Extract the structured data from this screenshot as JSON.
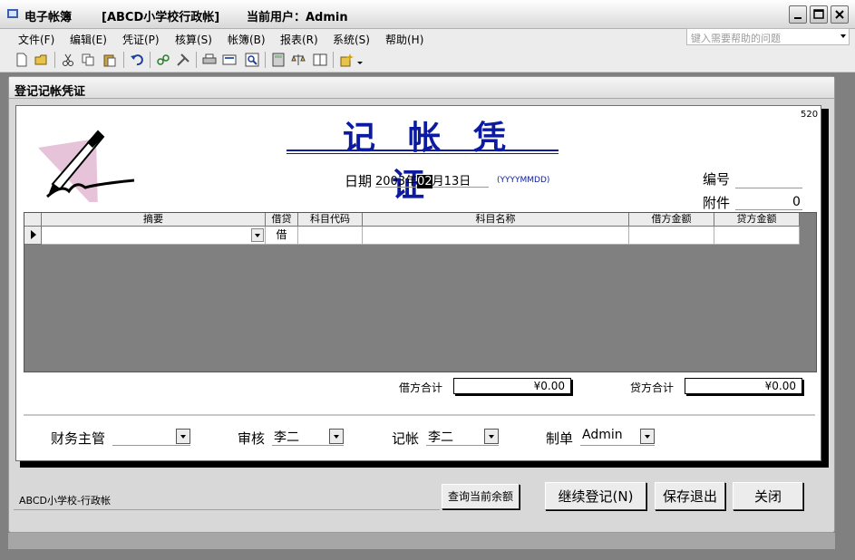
{
  "titlebar": {
    "app_name": "电子帐簿",
    "book_name": "[ABCD小学校行政帐]",
    "current_user": "当前用户：Admin"
  },
  "menu": [
    "文件(F)",
    "编辑(E)",
    "凭证(P)",
    "核算(S)",
    "帐簿(B)",
    "报表(R)",
    "系统(S)",
    "帮助(H)"
  ],
  "help_search": {
    "placeholder": "键入需要帮助的问题"
  },
  "toolbar_icons": [
    "new-icon",
    "open-icon",
    "cut-icon",
    "copy-icon",
    "paste-icon",
    "undo-icon",
    "link-icon",
    "tools-icon",
    "print-icon",
    "preview-icon",
    "zoom-icon",
    "calculator-icon",
    "balance-icon",
    "ledger-icon",
    "wizard-icon"
  ],
  "window": {
    "title": "登记记帐凭证"
  },
  "voucher": {
    "page_code": "520",
    "title": "记帐凭证",
    "date_label": "日期",
    "date": {
      "year": "2003",
      "year_unit": "年",
      "month": "02",
      "month_unit": "月",
      "day": "13",
      "day_unit": "日"
    },
    "date_hint": "(YYYYMMDD)",
    "number_label": "编号",
    "number_value": "",
    "attach_label": "附件",
    "attach_value": "0"
  },
  "grid": {
    "headers": [
      "摘要",
      "借贷",
      "科目代码",
      "科目名称",
      "借方金额",
      "贷方金额"
    ],
    "rows": [
      {
        "summary": "",
        "dc": "借",
        "code": "",
        "name": "",
        "debit": "",
        "credit": ""
      }
    ]
  },
  "totals": {
    "debit_label": "借方合计",
    "debit_value": "¥0.00",
    "credit_label": "贷方合计",
    "credit_value": "¥0.00"
  },
  "signatures": {
    "supervisor_label": "财务主管",
    "supervisor_value": "",
    "auditor_label": "审核",
    "auditor_value": "李二",
    "bookkeeper_label": "记帐",
    "bookkeeper_value": "李二",
    "preparer_label": "制单",
    "preparer_value": "Admin"
  },
  "status": {
    "book": "ABCD小学校-行政帐"
  },
  "buttons": {
    "query_balance": "查询当前余额",
    "continue": "继续登记(N)",
    "save_exit": "保存退出",
    "close": "关闭"
  }
}
